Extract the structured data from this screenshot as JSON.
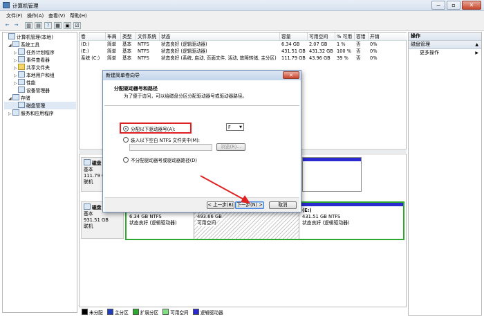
{
  "window": {
    "title": "计算机管理",
    "controls": {
      "minimize": "−",
      "restore": "▫",
      "close": "✕"
    }
  },
  "menu": {
    "items": [
      "文件(F)",
      "操作(A)",
      "查看(V)",
      "帮助(H)"
    ]
  },
  "toolbar": {
    "buttons": [
      "←",
      "→",
      "▥",
      "▤",
      "?",
      "▦",
      "▣",
      "☑"
    ]
  },
  "tree": {
    "items": [
      {
        "label": "计算机管理(本地)",
        "level": 0,
        "expand": ""
      },
      {
        "label": "系统工具",
        "level": 1,
        "expand": "◢"
      },
      {
        "label": "任务计划程序",
        "level": 2,
        "expand": "▷"
      },
      {
        "label": "事件查看器",
        "level": 2,
        "expand": "▷"
      },
      {
        "label": "共享文件夹",
        "level": 2,
        "expand": "▷"
      },
      {
        "label": "本地用户和组",
        "level": 2,
        "expand": "▷"
      },
      {
        "label": "性能",
        "level": 2,
        "expand": "▷"
      },
      {
        "label": "设备管理器",
        "level": 2,
        "expand": ""
      },
      {
        "label": "存储",
        "level": 1,
        "expand": "◢"
      },
      {
        "label": "磁盘管理",
        "level": 2,
        "expand": ""
      },
      {
        "label": "服务和应用程序",
        "level": 1,
        "expand": "▷"
      }
    ]
  },
  "volume_list": {
    "columns": [
      "卷",
      "布局",
      "类型",
      "文件系统",
      "状态",
      "容量",
      "可用空间",
      "% 可用",
      "容错",
      "开销"
    ],
    "rows": [
      [
        "(D:)",
        "简单",
        "基本",
        "NTFS",
        "状态良好 (逻辑驱动器)",
        "6.34 GB",
        "2.07 GB",
        "1 %",
        "否",
        "0%"
      ],
      [
        "(E:)",
        "简单",
        "基本",
        "NTFS",
        "状态良好 (逻辑驱动器)",
        "431.51 GB",
        "431.32 GB",
        "100 %",
        "否",
        "0%"
      ],
      [
        "系统 (C:)",
        "简单",
        "基本",
        "NTFS",
        "状态良好 (系统, 启动, 页面文件, 活动, 故障转储, 主分区)",
        "111.79 GB",
        "43.96 GB",
        "39 %",
        "否",
        "0%"
      ]
    ]
  },
  "disks": [
    {
      "name": "磁盘 0",
      "type": "基本",
      "size": "111.79 GB",
      "state": "联机"
    },
    {
      "name": "磁盘 1",
      "type": "基本",
      "size": "931.51 GB",
      "state": "联机",
      "partitions": [
        {
          "label": "",
          "size": "6.34 GB NTFS",
          "status": "状态良好 (逻辑驱动器)"
        },
        {
          "label": "",
          "size": "493.66 GB",
          "status": "可用空间"
        },
        {
          "label": "(E:)",
          "size": "431.51 GB NTFS",
          "status": "状态良好 (逻辑驱动器)"
        }
      ]
    }
  ],
  "legend": {
    "items": [
      {
        "label": "未分配",
        "color": "#000000"
      },
      {
        "label": "主分区",
        "color": "#1f3fbf"
      },
      {
        "label": "扩展分区",
        "color": "#2fa82f"
      },
      {
        "label": "可用空间",
        "color": "#7ee07e"
      },
      {
        "label": "逻辑驱动器",
        "color": "#2a2ad0"
      }
    ]
  },
  "actions": {
    "header": "操作",
    "section": "磁盘管理",
    "more": "更多操作"
  },
  "dialog": {
    "title": "新建简单卷向导",
    "heading": "分配驱动器号和路径",
    "subheading": "为了便于访问，可以给磁盘分区分配驱动器号或驱动器路径。",
    "option1": "分配以下驱动器号(A):",
    "drive_letter": "F",
    "option2": "装入以下空白 NTFS 文件夹中(M):",
    "browse": "浏览(R)...",
    "option3": "不分配驱动器号或驱动器路径(D)",
    "back": "< 上一步(B)",
    "next": "下一步(N) >",
    "cancel": "取消",
    "close": "✕"
  }
}
